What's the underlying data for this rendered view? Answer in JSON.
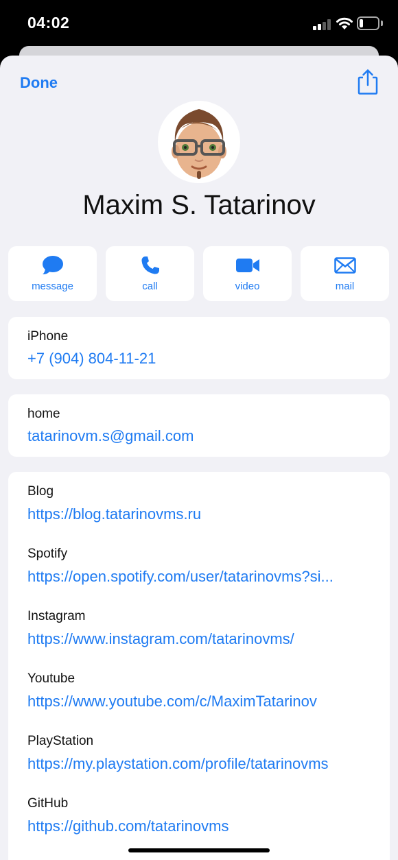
{
  "status_bar": {
    "time": "04:02",
    "battery_level": 0.2
  },
  "header": {
    "done_label": "Done",
    "share_icon": "share-icon"
  },
  "contact": {
    "name": "Maxim S. Tatarinov",
    "avatar": "memoji-avatar"
  },
  "actions": [
    {
      "label": "message",
      "icon": "message-icon"
    },
    {
      "label": "call",
      "icon": "phone-icon"
    },
    {
      "label": "video",
      "icon": "video-icon"
    },
    {
      "label": "mail",
      "icon": "mail-icon"
    }
  ],
  "phone": {
    "label": "iPhone",
    "value": "+7 (904) 804-11-21"
  },
  "email": {
    "label": "home",
    "value": "tatarinovm.s@gmail.com"
  },
  "urls": [
    {
      "label": "Blog",
      "value": "https://blog.tatarinovms.ru"
    },
    {
      "label": "Spotify",
      "value": "https://open.spotify.com/user/tatarinovms?si..."
    },
    {
      "label": "Instagram",
      "value": "https://www.instagram.com/tatarinovms/"
    },
    {
      "label": "Youtube",
      "value": "https://www.youtube.com/c/MaximTatarinov"
    },
    {
      "label": "PlayStation",
      "value": "https://my.playstation.com/profile/tatarinovms"
    },
    {
      "label": "GitHub",
      "value": "https://github.com/tatarinovms"
    }
  ],
  "colors": {
    "accent": "#1f7bf2",
    "background": "#f1f1f6",
    "card": "#ffffff"
  }
}
